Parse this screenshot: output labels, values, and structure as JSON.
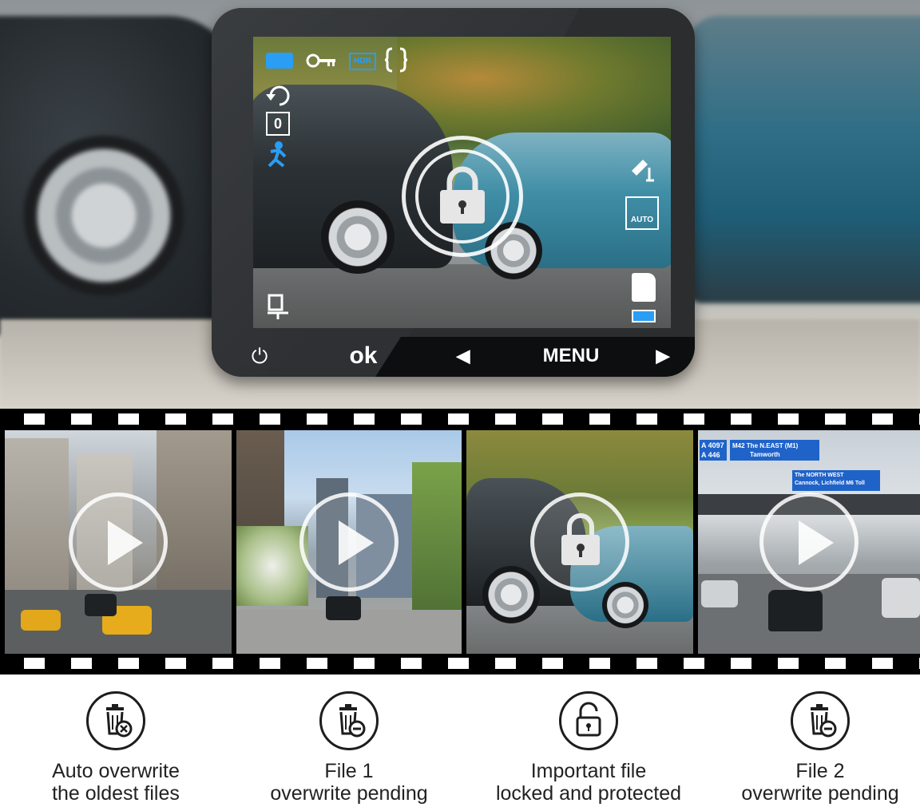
{
  "device": {
    "buttons": {
      "power": "⏻",
      "ok": "ok",
      "left": "◀",
      "menu": "MENU",
      "right": "▶"
    },
    "osd": {
      "hdr": "HDR",
      "auto": "AUTO",
      "sensor_value": "0"
    }
  },
  "film_frames": [
    {
      "scene": "city-street-taxis",
      "overlay": "play-icon"
    },
    {
      "scene": "school-road",
      "overlay": "play-icon"
    },
    {
      "scene": "collision",
      "overlay": "lock-icon"
    },
    {
      "scene": "motorway-signs",
      "overlay": "play-icon"
    }
  ],
  "frame4_signs": {
    "a1": "A 4097",
    "a2": "A 446",
    "m42": "M42",
    "sign_n_east": "The N.EAST (M1)",
    "sign_tamworth": "Tamworth",
    "nw1": "The NORTH WEST",
    "nw2": "Cannock, Lichfield",
    "m6": "M6 Toll"
  },
  "features": [
    {
      "icon": "trash-x-icon",
      "line1": "Auto overwrite",
      "line2": "the oldest files"
    },
    {
      "icon": "trash-minus-icon",
      "line1": "File 1",
      "line2": "overwrite pending"
    },
    {
      "icon": "unlock-icon",
      "line1": "Important file",
      "line2": "locked and protected"
    },
    {
      "icon": "trash-minus-icon",
      "line1": "File 2",
      "line2": "overwrite pending"
    }
  ],
  "colors": {
    "osd_blue": "#2a9df4",
    "device_body": "#2b2d2f",
    "film_black": "#000000",
    "sign_blue": "#1f63c9"
  }
}
